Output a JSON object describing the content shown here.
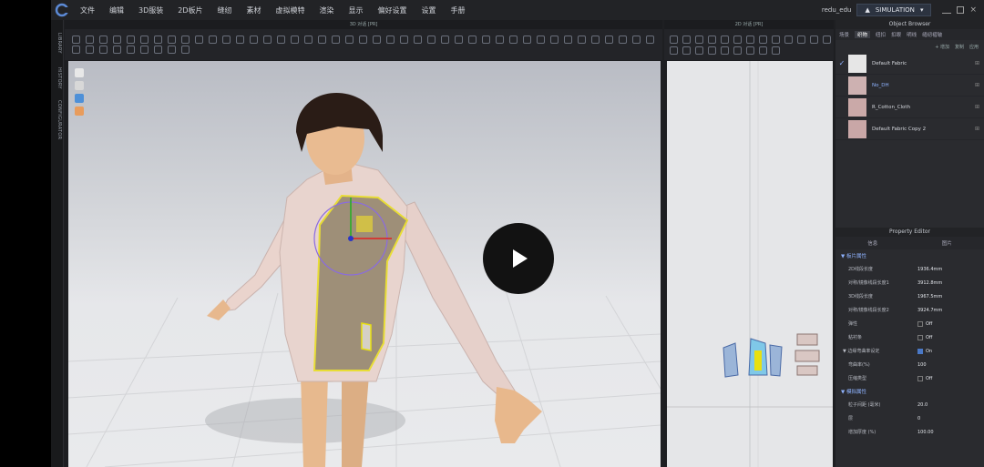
{
  "menubar": {
    "items": [
      "文件",
      "编辑",
      "3D服装",
      "2D板片",
      "缝纫",
      "素材",
      "虚拟模特",
      "渲染",
      "显示",
      "偏好设置",
      "设置",
      "手册"
    ],
    "user": "redu_edu",
    "mode": "SIMULATION"
  },
  "sidetabs": [
    "LIBRARY",
    "HISTORY",
    "CONFIGURATOR"
  ],
  "panel3d": {
    "title": "3D 对话 [PR]"
  },
  "panel2d": {
    "title": "2D 对话 [PR]"
  },
  "object_browser": {
    "title": "Object Browser",
    "tabs": [
      "场景",
      "织物",
      "纽扣",
      "扣眼",
      "明线",
      "缝纫褶皱"
    ],
    "active_tab": "织物",
    "actions": [
      "+ 增加",
      "复制",
      "应用"
    ],
    "fabrics": [
      {
        "name": "Default Fabric",
        "color": "#e6e6e6",
        "checked": true
      },
      {
        "name": "No_DH",
        "color": "#cdb1b1",
        "checked": false
      },
      {
        "name": "R_Cotton_Cloth",
        "color": "#caa9a8",
        "checked": false
      },
      {
        "name": "Default Fabric Copy 2",
        "color": "#c9a7a7",
        "checked": false
      }
    ]
  },
  "property_editor": {
    "title": "Property Editor",
    "tabs": [
      "信息",
      "图片"
    ],
    "section1": "板片属性",
    "rows": [
      {
        "label": "2D线段长度",
        "value": "1936.4mm"
      },
      {
        "label": "对称/镜像线段长度1",
        "value": "3912.8mm"
      },
      {
        "label": "3D线段长度",
        "value": "1967.5mm"
      },
      {
        "label": "对称/镜像线段长度2",
        "value": "3924.7mm"
      },
      {
        "label": "弹性",
        "value": "Off",
        "check": false
      },
      {
        "label": "粘衬条",
        "value": "Off",
        "check": false
      },
      {
        "label": "▼ 边缘弯曲率设定",
        "value": "On",
        "check": true
      },
      {
        "label": "弯曲率(%)",
        "value": "100"
      },
      {
        "label": "压缩类型",
        "value": "Off",
        "check": false
      }
    ],
    "section2": "模拟属性",
    "rows2": [
      {
        "label": "粒子间距 (毫米)",
        "value": "20.0"
      },
      {
        "label": "层",
        "value": "0"
      },
      {
        "label": "增加厚度 (%)",
        "value": "100.00"
      }
    ]
  },
  "colors": {
    "accent": "#4a78c6",
    "selection": "#e8e010"
  }
}
